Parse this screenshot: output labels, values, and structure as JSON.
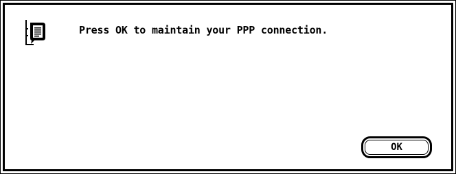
{
  "dialog": {
    "icon": "document-speech-icon",
    "message": "Press OK to maintain your PPP connection.",
    "ok_label": "OK"
  },
  "colors": {
    "background": "#ffffff",
    "border": "#000000",
    "text": "#000000"
  }
}
